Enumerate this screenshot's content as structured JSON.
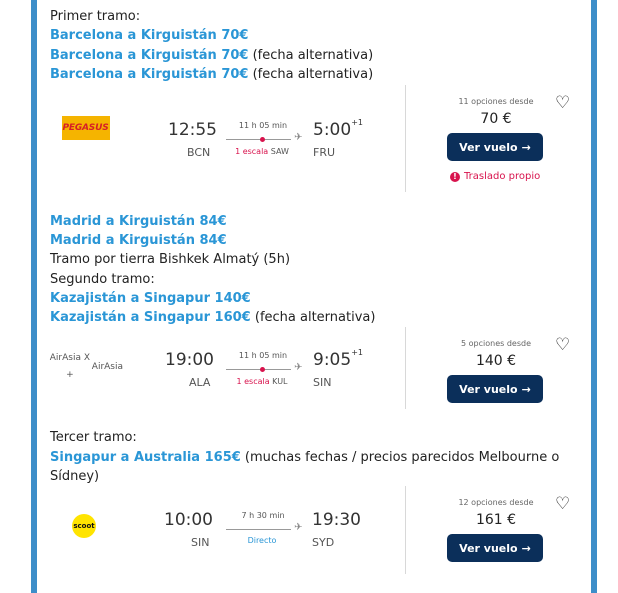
{
  "lines": {
    "l1": "Primer tramo:",
    "l2": "Barcelona a Kirguistán 70€",
    "l3": "Barcelona a Kirguistán 70€",
    "l3_note": " (fecha alternativa)",
    "l4": "Barcelona a Kirguistán 70€",
    "l4_note": " (fecha alternativa)",
    "l5": "Madrid a Kirguistán 84€",
    "l6": "Madrid a Kirguistán 84€",
    "l7": "Tramo por tierra Bishkek Almatý (5h)",
    "l8": "Segundo tramo:",
    "l9": "Kazajistán a Singapur 140€",
    "l10": "Kazajistán a Singapur 160€",
    "l10_note": " (fecha alternativa)",
    "l11": "Tercer tramo:",
    "l12": "Singapur a Australia 165€",
    "l12_note": " (muchas fechas / precios parecidos Melbourne o",
    "l13": "Sídney)"
  },
  "flights": [
    {
      "airline": "PEGASUS",
      "dep_time": "12:55",
      "dep_code": "BCN",
      "duration": "11 h 05 min",
      "stops": "1 escala",
      "via": "SAW",
      "arr_time": "5:00",
      "plus_day": "+1",
      "arr_code": "FRU",
      "options": "11 opciones desde",
      "price": "70 €",
      "button": "Ver vuelo",
      "warning": "Traslado propio"
    },
    {
      "airline_line1": "AirAsia X +",
      "airline_line2": "AirAsia",
      "dep_time": "19:00",
      "dep_code": "ALA",
      "duration": "11 h 05 min",
      "stops": "1 escala",
      "via": "KUL",
      "arr_time": "9:05",
      "plus_day": "+1",
      "arr_code": "SIN",
      "options": "5 opciones desde",
      "price": "140 €",
      "button": "Ver vuelo"
    },
    {
      "airline": "scoot",
      "dep_time": "10:00",
      "dep_code": "SIN",
      "duration": "7 h 30 min",
      "stops": "Directo",
      "arr_time": "19:30",
      "arr_code": "SYD",
      "options": "12 opciones desde",
      "price": "161 €",
      "button": "Ver vuelo"
    }
  ],
  "icons": {
    "heart": "heart-icon",
    "arrow": "arrow-right-icon",
    "plane": "plane-icon",
    "warning": "exclamation-icon"
  },
  "colors": {
    "link": "#2a96d6",
    "accent": "#d8134d",
    "button": "#0b2f5a",
    "frame": "#3d8ec9"
  }
}
